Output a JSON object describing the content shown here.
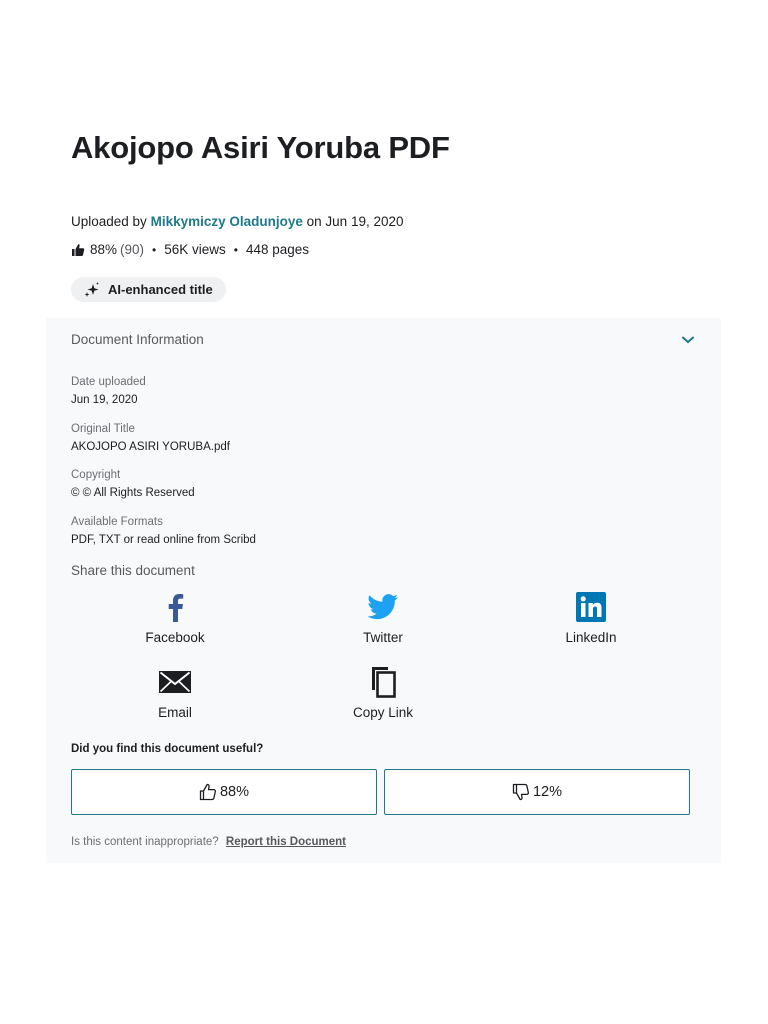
{
  "document": {
    "title": "Akojopo Asiri Yoruba PDF",
    "uploaded_by_prefix": "Uploaded by",
    "author": "Mikkymiczy Oladunjoye",
    "uploaded_on": "on Jun 19, 2020",
    "rating_percent": "88%",
    "rating_count": "(90)",
    "views": "56K views",
    "pages": "448 pages",
    "ai_chip_label": "AI-enhanced title"
  },
  "info_panel": {
    "heading": "Document Information",
    "fields": [
      {
        "label": "Date uploaded",
        "value": "Jun 19, 2020"
      },
      {
        "label": "Original Title",
        "value": "AKOJOPO ASIRI YORUBA.pdf"
      },
      {
        "label": "Copyright",
        "value": "© © All Rights Reserved"
      },
      {
        "label": "Available Formats",
        "value": "PDF, TXT or read online from Scribd"
      }
    ]
  },
  "share": {
    "heading": "Share this document",
    "items": [
      {
        "label": "Facebook",
        "icon": "facebook-icon"
      },
      {
        "label": "Twitter",
        "icon": "twitter-icon"
      },
      {
        "label": "LinkedIn",
        "icon": "linkedin-icon"
      },
      {
        "label": "Email",
        "icon": "email-icon"
      },
      {
        "label": "Copy Link",
        "icon": "copy-icon"
      }
    ]
  },
  "feedback": {
    "question": "Did you find this document useful?",
    "up_percent": "88%",
    "down_percent": "12%",
    "report_prefix": "Is this content inappropriate?",
    "report_link": "Report this Document"
  },
  "colors": {
    "accent": "#1d7a8b",
    "facebook": "#3b5998",
    "twitter": "#1da1f2",
    "linkedin": "#0077b5",
    "panel_bg": "#f8f9fa"
  }
}
